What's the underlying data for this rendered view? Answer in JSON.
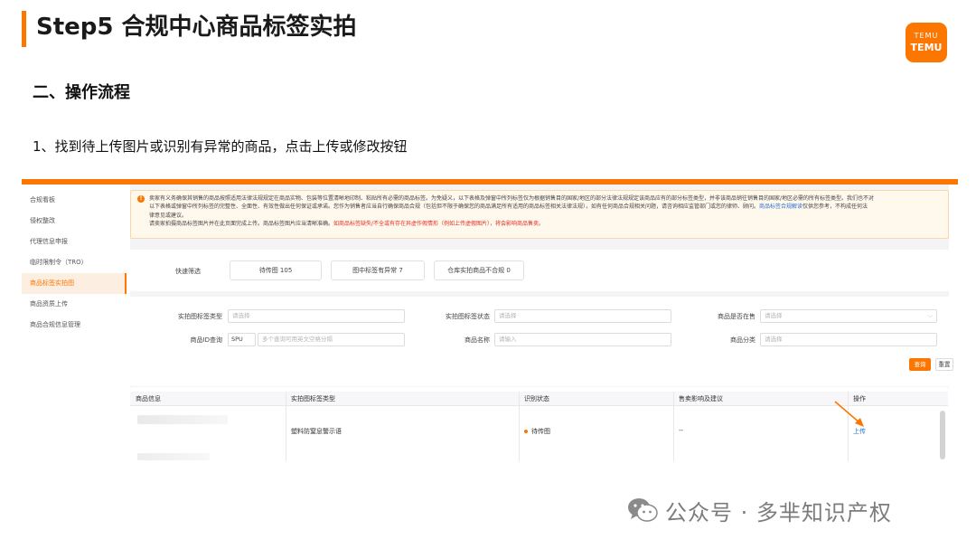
{
  "slide": {
    "title": "Step5 合规中心商品标签实拍",
    "logo_top": "TEMU",
    "logo_bottom": "TEMU",
    "section_title": "二、操作流程",
    "step_text": "1、找到待上传图片或识别有异常的商品，点击上传或修改按钮",
    "accent_color": "#fb7701"
  },
  "sidebar": {
    "items": [
      {
        "label": "合规看板"
      },
      {
        "label": "侵权整改"
      },
      {
        "label": "代理信息申报"
      },
      {
        "label": "临时限制令（TRO）"
      },
      {
        "label": "商品标签实拍图"
      },
      {
        "label": "商品资质上传"
      },
      {
        "label": "商品合规信息管理"
      }
    ],
    "active_index": 4
  },
  "notice": {
    "icon": "warning-icon",
    "line1": "卖家有义务确保其销售的商品按照适用法律法规规定在商品实物、包装等位置清晰地印制、粘贴所有必需的商品标签。为免疑义，以下表格及弹窗中所列标签仅为根据销售目的国家/地区的部分法律法规规定该商品应有的部分标签类型，并非该商品销往销售目的国家/地区必需的所有标签类型。我们也不对",
    "line2_a": "以下表格或弹窗中所列标签的完整性、全面性、有效性做出任何保证或承诺。您作为销售者应当自行确保商品合规（包括但不限于确保您的商品满足所有适用的商品标签相关法律法规），如有任何商品合规相关问题，请咨询相应监管部门或您的律师、顾问。",
    "line2_link": "商品标签合规解读",
    "line2_b": "仅供您参考，不构成任何法",
    "line3": "律意见或建议。",
    "line4_a": "请卖家拍摄商品标签图片并在此页面完成上传。商品标签图片应当清晰准确。",
    "line4_red": "如商品标签缺失/不全或有存在异虚作假情形（例如上传虚假图片），将会影响商品售卖。"
  },
  "quick_filter": {
    "label": "快速筛选",
    "chips": [
      {
        "label": "待传图 105"
      },
      {
        "label": "图中标签有异常 7"
      },
      {
        "label": "仓库实拍商品不合规 0"
      }
    ]
  },
  "filters": {
    "label_type": {
      "label": "实拍图标签类型",
      "placeholder": "请选择"
    },
    "label_status": {
      "label": "实拍图标签状态",
      "placeholder": "请选择"
    },
    "on_sale": {
      "label": "商品是否在售",
      "placeholder": "请选择"
    },
    "id_query": {
      "label": "商品ID查询",
      "select_value": "SPU",
      "placeholder": "多个查询可用英文空格分隔"
    },
    "product_name": {
      "label": "商品名称",
      "placeholder": "请输入"
    },
    "category": {
      "label": "商品分类",
      "placeholder": "请选择"
    },
    "search_label": "查询",
    "reset_label": "重置"
  },
  "table": {
    "columns": [
      "商品信息",
      "实拍图标签类型",
      "识别状态",
      "售卖影响及建议",
      "操作"
    ],
    "rows": [
      {
        "label_type": "塑料防窒息警示语",
        "status": "待传图",
        "impact": "--",
        "action": "上传"
      }
    ]
  },
  "watermark": {
    "icon": "wechat-icon",
    "text": "公众号 · 多芈知识产权"
  }
}
